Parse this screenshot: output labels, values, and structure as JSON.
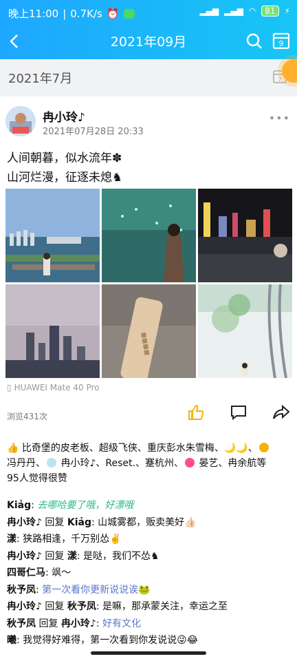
{
  "status_bar": {
    "time": "晚上11:00",
    "speed": "0.7K/s",
    "battery": "81"
  },
  "header": {
    "title": "2021年09月"
  },
  "month_section": {
    "label": "2021年7月"
  },
  "post": {
    "author": "冉小玲♪",
    "timestamp": "2021年07月28日 20:33",
    "content_lines": [
      "人间朝暮，似水流年✽",
      "山河烂漫，征逐未熄♞"
    ],
    "device": "HUAWEI Mate 40 Pro",
    "views": "浏览431次",
    "likes_text_1": "比奇堡的皮老板、超级飞侠、重庆彭水朱雪梅、",
    "likes_text_2": "冯丹丹、",
    "likes_text_3": "冉小玲♪、Reset.、蹇杭州、",
    "likes_text_4": "晏艺、冉余航等",
    "likes_text_5": "95人觉得很赞"
  },
  "comments": [
    {
      "name": "Kiảg",
      "text": "去哪哈要了哦，好漂哦"
    },
    {
      "name": "冉小玲♪",
      "reply": "回复",
      "to": "Kiảg",
      "text": "山城雾都，贩卖美好👍🏻"
    },
    {
      "name": "漾",
      "text": "狭路相逢，千万别怂✌️"
    },
    {
      "name": "冉小玲♪",
      "reply": "回复",
      "to": "漾",
      "text": "是哒，我们不怂♞"
    },
    {
      "name": "四哥仁马",
      "text": "飒～"
    },
    {
      "name": "秋予凤",
      "text": "第一次看你更新说说诶🐸"
    },
    {
      "name": "冉小玲♪",
      "reply": "回复",
      "to": "秋予凤",
      "text": "是嘛，那承蒙关注，幸运之至"
    },
    {
      "name": "秋予凤",
      "reply": "回复",
      "to": "冉小玲♪",
      "text": "好有文化"
    },
    {
      "name": "曦",
      "text": "我觉得好难得，第一次看到你发说说😜😂"
    }
  ],
  "colors": {
    "header": "#1ea7ff",
    "like": "#f5b400",
    "link": "#5a78c8"
  }
}
